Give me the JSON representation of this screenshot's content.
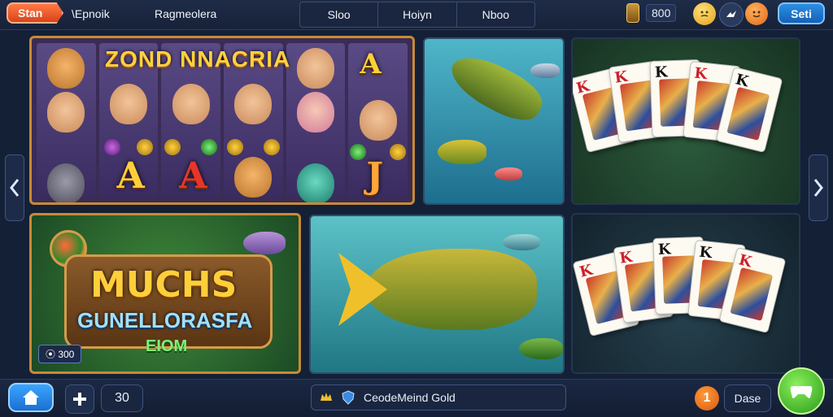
{
  "topbar": {
    "start_label": "Stan",
    "text1": "\\Epnoik",
    "text2": "Ragmeolera",
    "tabs": [
      {
        "label": "Sloo"
      },
      {
        "label": "Hoiyn"
      },
      {
        "label": "Nboo"
      }
    ],
    "coins": "800",
    "settings_label": "Seti",
    "icons": [
      "lantern-icon",
      "emoji-face-icon",
      "bird-icon",
      "emoji-face-icon"
    ]
  },
  "tiles": {
    "slots_a_title": "ZOND NNACRIA",
    "slots_a_letters": [
      "A",
      "A",
      "A",
      "J"
    ],
    "slots_b_logo_line1": "MUCHS",
    "slots_b_logo_line2": "GUNELLORASFA",
    "slots_b_logo_line3": "EIOM",
    "slots_b_badge": "⦿ 300",
    "card_ranks": [
      "K",
      "K",
      "K",
      "K",
      "K",
      "K"
    ]
  },
  "bottombar": {
    "count": "30",
    "status_text": "CeodeMeind Gold",
    "notif_count": "1",
    "save_label": "Dase"
  },
  "colors": {
    "accent_orange": "#d9431a",
    "accent_blue": "#1561b8",
    "accent_green": "#2a9a1a",
    "frame_gold": "#c98a34"
  }
}
